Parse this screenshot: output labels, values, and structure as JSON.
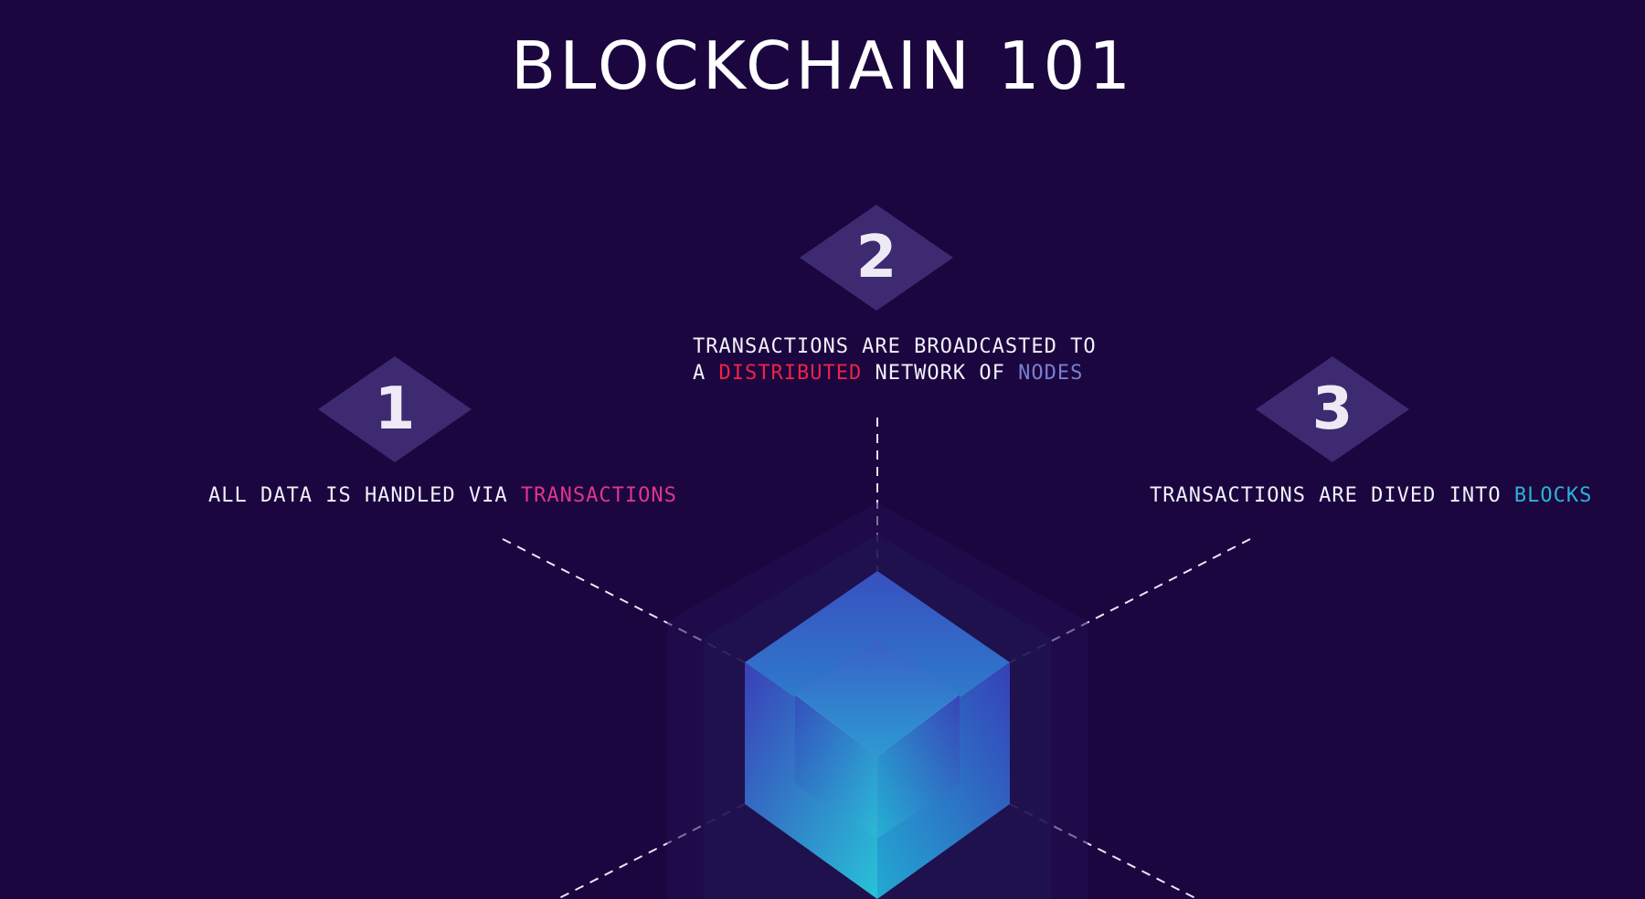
{
  "title": "BLOCKCHAIN 101",
  "colors": {
    "background": "#1b0640",
    "diamond": "#3d2a70",
    "pink": "#e0368a",
    "red": "#ee2244",
    "slate": "#7b7fcf",
    "cyan": "#2bb3d6",
    "cube_blue": "#3a3fb8",
    "cube_teal": "#28c3d8"
  },
  "steps": [
    {
      "number": "1",
      "text_before": "ALL DATA IS HANDLED VIA ",
      "highlight": "TRANSACTIONS"
    },
    {
      "number": "2",
      "line1": "TRANSACTIONS ARE BROADCASTED TO",
      "line2_a": "A ",
      "line2_highlight1": "DISTRIBUTED",
      "line2_mid": " NETWORK OF ",
      "line2_highlight2": "NODES"
    },
    {
      "number": "3",
      "text_before": "TRANSACTIONS ARE DIVED INTO ",
      "highlight": "BLOCKS"
    }
  ]
}
